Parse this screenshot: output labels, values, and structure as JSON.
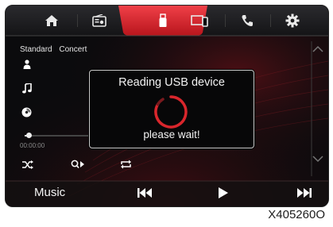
{
  "tabs": [
    {
      "name": "home",
      "icon": "home-icon",
      "active": false
    },
    {
      "name": "radio",
      "icon": "radio-icon",
      "active": false
    },
    {
      "name": "usb",
      "icon": "usb-icon",
      "active": true
    },
    {
      "name": "screen-mirror",
      "icon": "phone-projection-icon",
      "active": false
    },
    {
      "name": "phone",
      "icon": "phone-icon",
      "active": false
    },
    {
      "name": "settings",
      "icon": "gear-icon",
      "active": false
    }
  ],
  "source": {
    "tag1": "Standard",
    "tag2": "Concert"
  },
  "player": {
    "time": "00:00:00",
    "progress": 0.03
  },
  "dialog": {
    "title": "Reading USB device",
    "message": "please wait!"
  },
  "bottom": {
    "label": "Music"
  },
  "figure_code": "X405260O",
  "colors": {
    "accent": "#d9262c",
    "dialog_border": "#c9c9c9",
    "background": "#0b0b0d"
  }
}
